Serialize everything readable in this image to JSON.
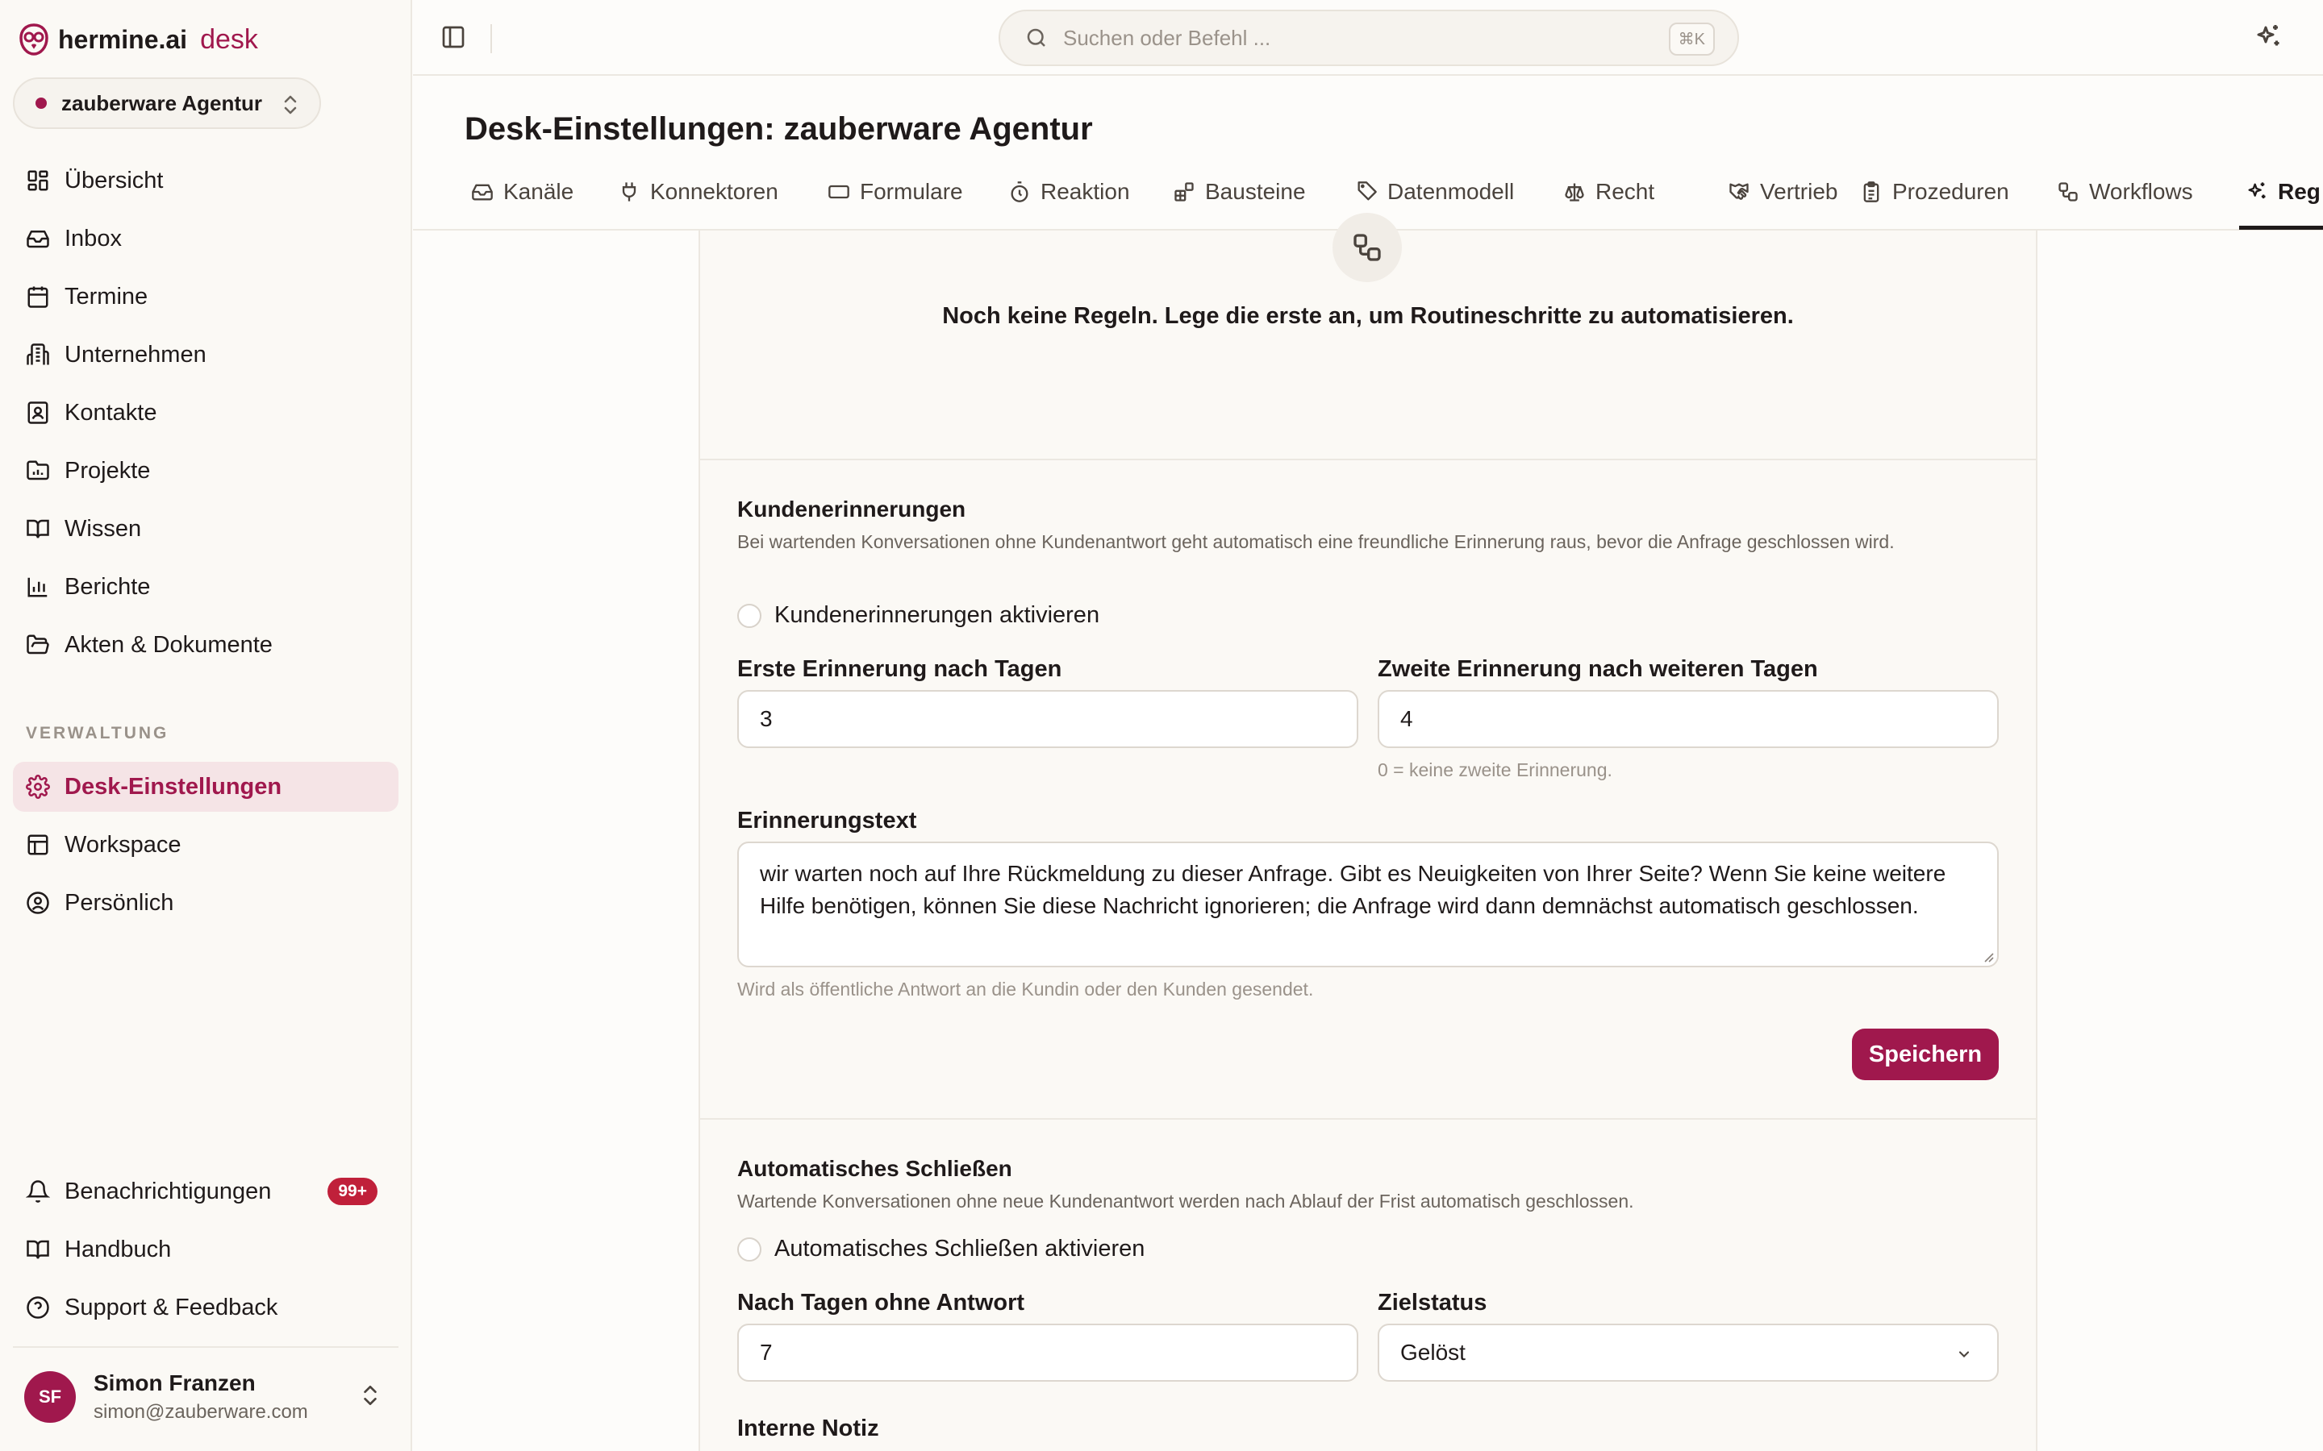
{
  "brand": {
    "name": "hermine.ai",
    "product": "desk"
  },
  "org": {
    "name": "zauberware Agentur"
  },
  "nav": {
    "items": [
      {
        "label": "Übersicht",
        "icon": "dashboard-icon"
      },
      {
        "label": "Inbox",
        "icon": "inbox-icon"
      },
      {
        "label": "Termine",
        "icon": "calendar-icon"
      },
      {
        "label": "Unternehmen",
        "icon": "building-icon"
      },
      {
        "label": "Kontakte",
        "icon": "contact-icon"
      },
      {
        "label": "Projekte",
        "icon": "folder-chart-icon"
      },
      {
        "label": "Wissen",
        "icon": "book-icon"
      },
      {
        "label": "Berichte",
        "icon": "bar-chart-icon"
      },
      {
        "label": "Akten & Dokumente",
        "icon": "folder-open-icon"
      }
    ],
    "section_label": "VERWALTUNG",
    "admin_items": [
      {
        "label": "Desk-Einstellungen",
        "icon": "gear-icon",
        "active": true
      },
      {
        "label": "Workspace",
        "icon": "layout-icon"
      },
      {
        "label": "Persönlich",
        "icon": "user-circle-icon"
      }
    ],
    "bottom_items": [
      {
        "label": "Benachrichtigungen",
        "icon": "bell-icon",
        "badge": "99+"
      },
      {
        "label": "Handbuch",
        "icon": "book-icon"
      },
      {
        "label": "Support & Feedback",
        "icon": "help-icon"
      }
    ]
  },
  "user": {
    "initials": "SF",
    "name": "Simon Franzen",
    "email": "simon@zauberware.com"
  },
  "search": {
    "placeholder": "Suchen oder Befehl ...",
    "shortcut": "⌘K"
  },
  "page": {
    "title": "Desk-Einstellungen: zauberware Agentur"
  },
  "tabs": [
    {
      "label": "Kanäle"
    },
    {
      "label": "Konnektoren"
    },
    {
      "label": "Formulare"
    },
    {
      "label": "Reaktion"
    },
    {
      "label": "Bausteine"
    },
    {
      "label": "Datenmodell"
    },
    {
      "label": "Recht"
    },
    {
      "label": "Vertrieb"
    },
    {
      "label": "Prozeduren"
    },
    {
      "label": "Workflows"
    },
    {
      "label": "Reg",
      "active": true
    }
  ],
  "empty_state": {
    "text": "Noch keine Regeln. Lege die erste an, um Routineschritte zu automatisieren."
  },
  "reminders": {
    "title": "Kundenerinnerungen",
    "description": "Bei wartenden Konversationen ohne Kundenantwort geht automatisch eine freundliche Erinnerung raus, bevor die Anfrage geschlossen wird.",
    "toggle_label": "Kundenerinnerungen aktivieren",
    "first_label": "Erste Erinnerung nach Tagen",
    "first_value": "3",
    "second_label": "Zweite Erinnerung nach weiteren Tagen",
    "second_value": "4",
    "second_hint": "0 = keine zweite Erinnerung.",
    "text_label": "Erinnerungstext",
    "text_value": "wir warten noch auf Ihre Rückmeldung zu dieser Anfrage. Gibt es Neuigkeiten von Ihrer Seite? Wenn Sie keine weitere Hilfe benötigen, können Sie diese Nachricht ignorieren; die Anfrage wird dann demnächst automatisch geschlossen.",
    "text_hint": "Wird als öffentliche Antwort an die Kundin oder den Kunden gesendet.",
    "save_label": "Speichern"
  },
  "autoclose": {
    "title": "Automatisches Schließen",
    "description": "Wartende Konversationen ohne neue Kundenantwort werden nach Ablauf der Frist automatisch geschlossen.",
    "toggle_label": "Automatisches Schließen aktivieren",
    "days_label": "Nach Tagen ohne Antwort",
    "days_value": "7",
    "status_label": "Zielstatus",
    "status_value": "Gelöst",
    "note_label": "Interne Notiz"
  },
  "colors": {
    "accent": "#a0184d",
    "badge": "#c0203a"
  }
}
